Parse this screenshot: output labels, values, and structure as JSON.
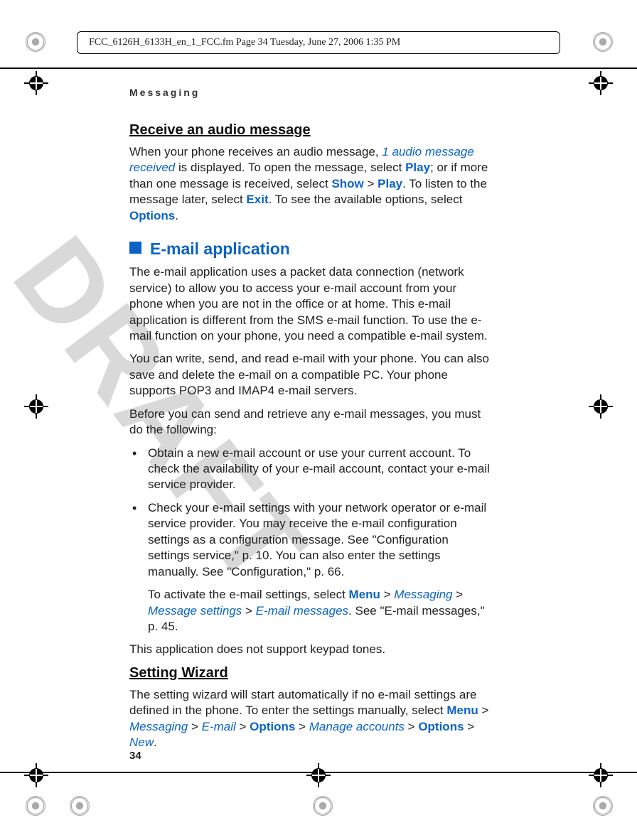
{
  "header": "FCC_6126H_6133H_en_1_FCC.fm  Page 34  Tuesday, June 27, 2006  1:35 PM",
  "running_head": "Messaging",
  "watermark": "DRAFT",
  "page_number": "34",
  "h_receive": "Receive an audio message",
  "p_receive_a": "When your phone receives an audio message, ",
  "p_receive_b": "1 audio message received",
  "p_receive_c": " is displayed. To open the message, select ",
  "play": "Play",
  "p_receive_d": "; or if more than one message is received, select ",
  "show": "Show",
  "gt": " > ",
  "p_receive_e": ". To listen to the message later, select ",
  "exit": "Exit",
  "p_receive_f": ". To see the available options, select ",
  "options": "Options",
  "period": ".",
  "h_email": "E-mail application",
  "p_email1": "The e-mail application uses a packet data connection (network service) to allow you to access your e-mail account from your phone when you are not in the office or at home. This e-mail application is different from the SMS e-mail function. To use the e-mail function on your phone, you need a compatible e-mail system.",
  "p_email2": "You can write, send, and read e-mail with your phone. You can also save and delete the e-mail on a compatible PC. Your phone supports POP3 and IMAP4 e-mail servers.",
  "p_email3": "Before you can send and retrieve any e-mail messages, you must do the following:",
  "li1": "Obtain a new e-mail account or use your current account. To check the availability of your e-mail account, contact your e-mail service provider.",
  "li2": "Check your e-mail settings with your network operator or e-mail service provider. You may receive the e-mail configuration settings as a configuration message. See \"Configuration settings service,\" p. 10. You can also enter the settings manually. See \"Configuration,\" p. 66.",
  "li2b_a": "To activate the e-mail settings, select ",
  "menu": "Menu",
  "messaging": "Messaging",
  "msg_settings": "Message settings",
  "email_msgs": "E-mail messages",
  "li2b_b": ". See \"E-mail messages,\" p. 45.",
  "p_email4": "This application does not support keypad tones.",
  "h_wizard": "Setting Wizard",
  "p_wizard_a": "The setting wizard will start automatically if no e-mail settings are defined in the phone. To enter the settings manually, select ",
  "email_item": "E-mail",
  "manage_acc": "Manage accounts",
  "new_item": "New"
}
